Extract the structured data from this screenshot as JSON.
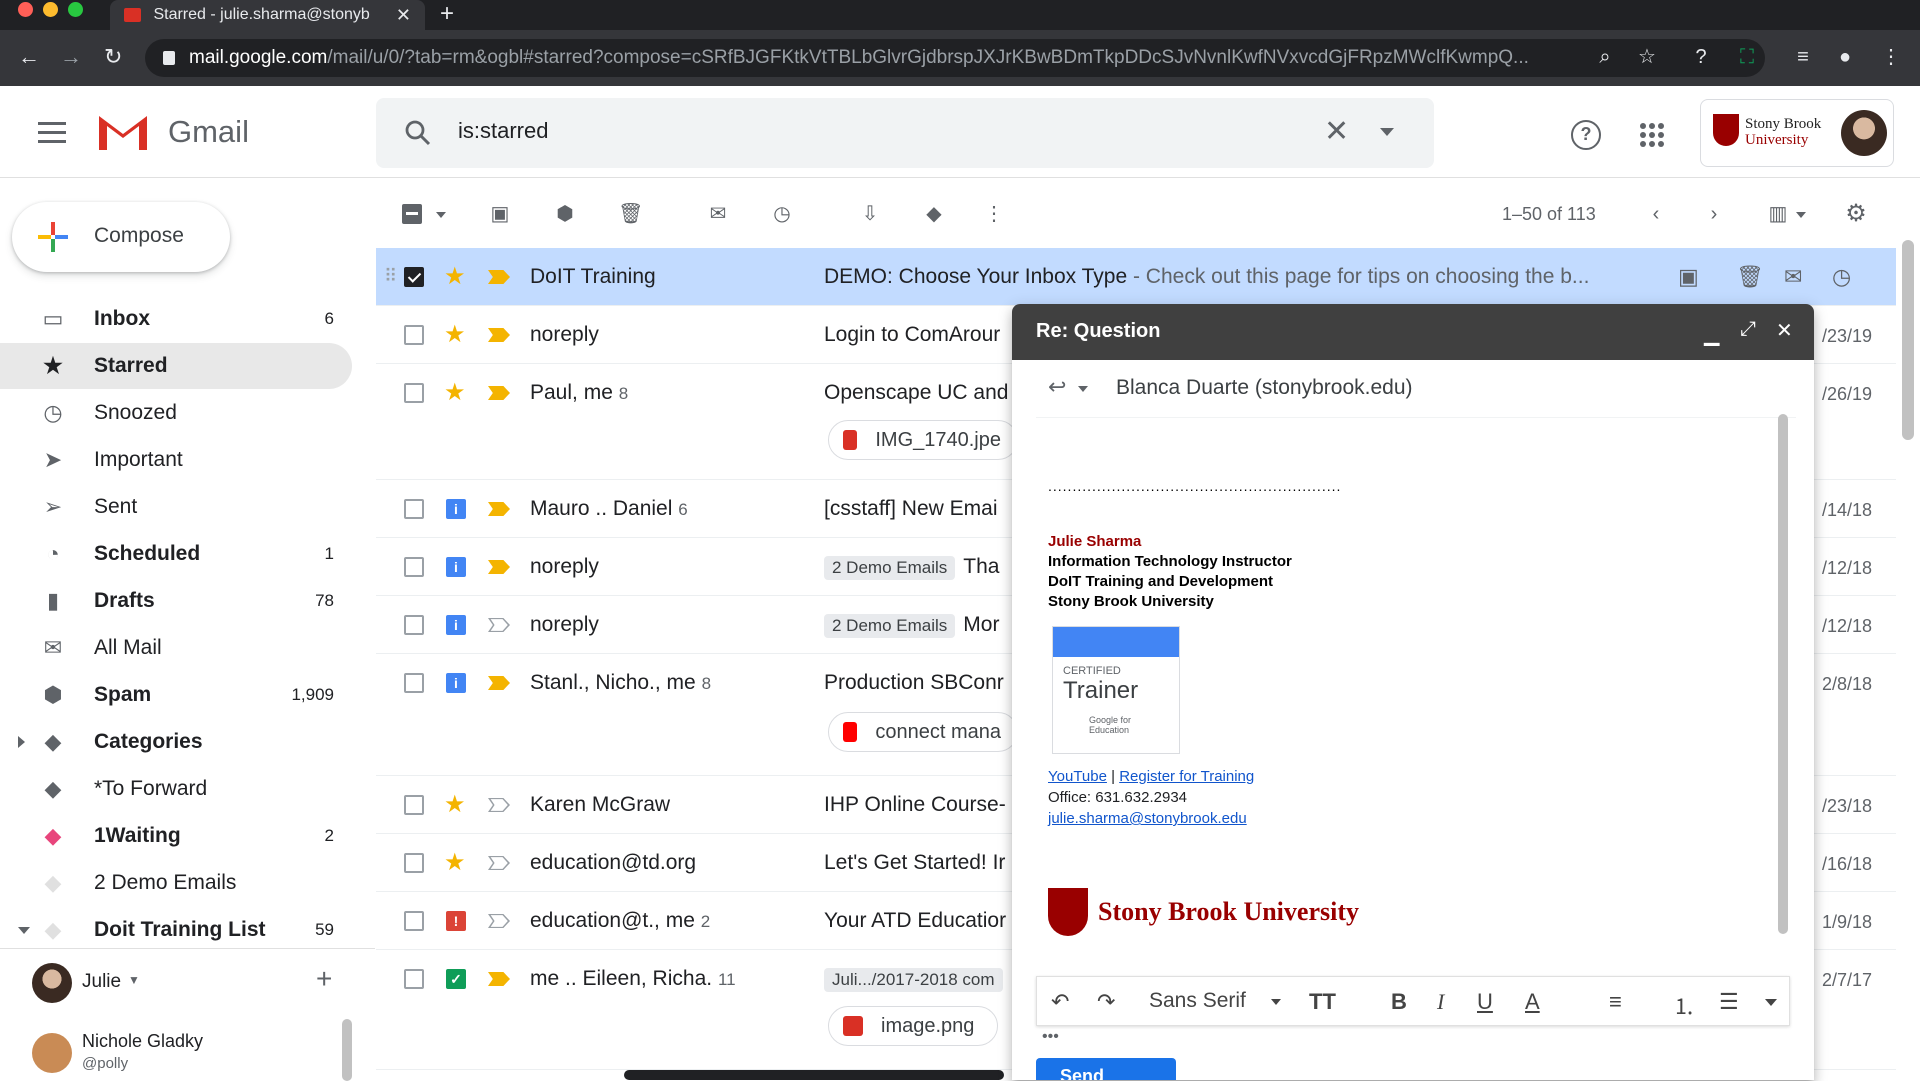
{
  "browser": {
    "tab_title": "Starred - julie.sharma@stonyb",
    "url_domain": "mail.google.com",
    "url_path": "/mail/u/0/?tab=rm&ogbl#starred?compose=cSRfBJGFKtkVtTBLbGlvrGjdbrspJXJrKBwBDmTkpDDcSJvNvnlKwfNVxvcdGjFRpzMWclfKwmpQ..."
  },
  "header": {
    "app_name": "Gmail",
    "search_value": "is:starred",
    "account_org_line1": "Stony Brook",
    "account_org_line2": "University"
  },
  "compose_label": "Compose",
  "sidebar": {
    "items": [
      {
        "label": "Inbox",
        "count": "6"
      },
      {
        "label": "Starred",
        "count": ""
      },
      {
        "label": "Snoozed",
        "count": ""
      },
      {
        "label": "Important",
        "count": ""
      },
      {
        "label": "Sent",
        "count": ""
      },
      {
        "label": "Scheduled",
        "count": "1"
      },
      {
        "label": "Drafts",
        "count": "78"
      },
      {
        "label": "All Mail",
        "count": ""
      },
      {
        "label": "Spam",
        "count": "1,909"
      },
      {
        "label": "Categories",
        "count": ""
      },
      {
        "label": "*To Forward",
        "count": ""
      },
      {
        "label": "1Waiting",
        "count": "2"
      },
      {
        "label": "2 Demo Emails",
        "count": ""
      },
      {
        "label": "Doit Training List",
        "count": "59"
      }
    ],
    "hangouts_user": "Julie",
    "contact_name": "Nichole Gladky",
    "contact_handle": "@polly",
    "label_colors": {
      "1Waiting": "#e8457c",
      "2 Demo Emails": "#e8eaed"
    }
  },
  "toolbar": {
    "pager": "1–50 of 113"
  },
  "emails": [
    {
      "sender": "DoIT Training",
      "count": "",
      "subject": "DEMO: Choose Your Inbox Type",
      "snippet": " - Check out this page for tips on choosing the b...",
      "date": ""
    },
    {
      "sender": "noreply",
      "count": "",
      "subject": "Login to ComArour",
      "snippet": "",
      "date": "/23/19"
    },
    {
      "sender": "Paul, me",
      "count": "8",
      "subject": "Openscape UC and",
      "snippet": "",
      "date": "/26/19",
      "attachment": "IMG_1740.jpe"
    },
    {
      "sender": "Mauro .. Daniel",
      "count": "6",
      "subject": "[csstaff] New Emai",
      "snippet": "",
      "date": "/14/18"
    },
    {
      "sender": "noreply",
      "count": "",
      "tag": "2 Demo Emails",
      "subject": "Tha",
      "snippet": "",
      "date": "/12/18"
    },
    {
      "sender": "noreply",
      "count": "",
      "tag": "2 Demo Emails",
      "subject": "Mor",
      "snippet": "",
      "date": "/12/18"
    },
    {
      "sender": "Stanl., Nicho., me",
      "count": "8",
      "subject": "Production SBConr",
      "snippet": "",
      "date": "2/8/18",
      "attachment": "connect mana"
    },
    {
      "sender": "Karen McGraw",
      "count": "",
      "subject": "IHP Online Course-",
      "snippet": "",
      "date": "/23/18"
    },
    {
      "sender": "education@td.org",
      "count": "",
      "subject": "Let's Get Started! Ir",
      "snippet": "",
      "date": "/16/18"
    },
    {
      "sender": "education@t., me",
      "count": "2",
      "subject": "Your ATD Educatior",
      "snippet": "",
      "date": "1/9/18"
    },
    {
      "sender": "me .. Eileen, Richa.",
      "count": "11",
      "tag": "Juli.../2017-2018 com",
      "subject": "",
      "snippet": "",
      "date": "2/7/17",
      "attachment": "image.png"
    }
  ],
  "compose": {
    "title": "Re: Question",
    "to": "Blanca Duarte (stonybrook.edu)",
    "divider": "............................................................",
    "sig_name": "Julie Sharma",
    "sig_title": "Information Technology Instructor",
    "sig_dept": "DoIT Training and Development",
    "sig_org": "Stony Brook University",
    "badge_top": "CERTIFIED",
    "badge_main": "Trainer",
    "badge_foot": "Google for Education",
    "link_youtube": "YouTube",
    "link_sep": " | ",
    "link_register": "Register for Training",
    "office": "Office: 631.632.2934",
    "email": "julie.sharma@stonybrook.edu",
    "logo_text": "Stony Brook University",
    "font": "Sans Serif",
    "send": "Send"
  },
  "colors": {
    "accent": "#1a73e8",
    "star": "#f4b400",
    "selected_row": "#c2dbff",
    "brand_red": "#990000"
  }
}
